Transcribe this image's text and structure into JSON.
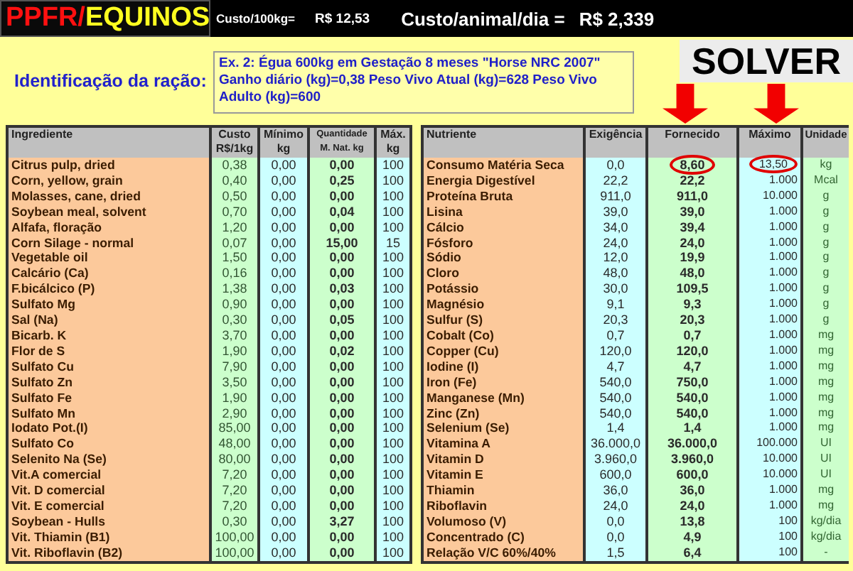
{
  "header": {
    "title_prefix": "PPFR/",
    "title_suffix": "EQUINOS",
    "cost_100kg_label": "Custo/100kg=",
    "cost_100kg_value": "R$ 12,53",
    "cost_day_label": "Custo/animal/dia =",
    "cost_day_value": "R$ 2,339"
  },
  "ration": {
    "label": "Identificação da ração:",
    "text": "Ex. 2: Égua 600kg em Gestação 8 meses  \"Horse NRC 2007\" Ganho diário (kg)=0,38  Peso Vivo Atual (kg)=628  Peso Vivo Adulto (kg)=600"
  },
  "solver_button": "SOLVER",
  "ingredients": {
    "columns": [
      "Ingrediente",
      "Custo\nR$/1kg",
      "Mínimo\nkg",
      "Quantidade\nM. Nat. kg",
      "Máx.\nkg"
    ],
    "rows": [
      {
        "name": "Citrus pulp, dried",
        "cost": "0,38",
        "min": "0,00",
        "qty": "0,00",
        "max": "100"
      },
      {
        "name": "Corn, yellow, grain",
        "cost": "0,40",
        "min": "0,00",
        "qty": "0,25",
        "max": "100"
      },
      {
        "name": "Molasses, cane, dried",
        "cost": "0,50",
        "min": "0,00",
        "qty": "0,00",
        "max": "100"
      },
      {
        "name": "Soybean meal, solvent",
        "cost": "0,70",
        "min": "0,00",
        "qty": "0,04",
        "max": "100"
      },
      {
        "name": "Alfafa, floração",
        "cost": "1,20",
        "min": "0,00",
        "qty": "0,00",
        "max": "100"
      },
      {
        "name": "Corn Silage - normal",
        "cost": "0,07",
        "min": "0,00",
        "qty": "15,00",
        "max": "15"
      },
      {
        "name": "Vegetable oil",
        "cost": "1,50",
        "min": "0,00",
        "qty": "0,00",
        "max": "100"
      },
      {
        "name": "Calcário (Ca)",
        "cost": "0,16",
        "min": "0,00",
        "qty": "0,00",
        "max": "100"
      },
      {
        "name": "F.bicálcico (P)",
        "cost": "1,38",
        "min": "0,00",
        "qty": "0,03",
        "max": "100"
      },
      {
        "name": "Sulfato Mg",
        "cost": "0,90",
        "min": "0,00",
        "qty": "0,00",
        "max": "100"
      },
      {
        "name": "Sal (Na)",
        "cost": "0,30",
        "min": "0,00",
        "qty": "0,05",
        "max": "100"
      },
      {
        "name": "Bicarb. K",
        "cost": "3,70",
        "min": "0,00",
        "qty": "0,00",
        "max": "100"
      },
      {
        "name": "Flor de S",
        "cost": "1,90",
        "min": "0,00",
        "qty": "0,02",
        "max": "100"
      },
      {
        "name": "Sulfato Cu",
        "cost": "7,90",
        "min": "0,00",
        "qty": "0,00",
        "max": "100"
      },
      {
        "name": "Sulfato Zn",
        "cost": "3,50",
        "min": "0,00",
        "qty": "0,00",
        "max": "100"
      },
      {
        "name": "Sulfato Fe",
        "cost": "1,90",
        "min": "0,00",
        "qty": "0,00",
        "max": "100"
      },
      {
        "name": "Sulfato Mn",
        "cost": "2,90",
        "min": "0,00",
        "qty": "0,00",
        "max": "100"
      },
      {
        "name": "Iodato Pot.(I)",
        "cost": "85,00",
        "min": "0,00",
        "qty": "0,00",
        "max": "100"
      },
      {
        "name": "Sulfato Co",
        "cost": "48,00",
        "min": "0,00",
        "qty": "0,00",
        "max": "100"
      },
      {
        "name": "Selenito Na (Se)",
        "cost": "80,00",
        "min": "0,00",
        "qty": "0,00",
        "max": "100"
      },
      {
        "name": "Vit.A comercial",
        "cost": "7,20",
        "min": "0,00",
        "qty": "0,00",
        "max": "100"
      },
      {
        "name": "Vit. D comercial",
        "cost": "7,20",
        "min": "0,00",
        "qty": "0,00",
        "max": "100"
      },
      {
        "name": "Vit. E comercial",
        "cost": "7,20",
        "min": "0,00",
        "qty": "0,00",
        "max": "100"
      },
      {
        "name": "Soybean - Hulls",
        "cost": "0,30",
        "min": "0,00",
        "qty": "3,27",
        "max": "100"
      },
      {
        "name": "Vit. Thiamin (B1)",
        "cost": "100,00",
        "min": "0,00",
        "qty": "0,00",
        "max": "100"
      },
      {
        "name": "Vit. Riboflavin (B2)",
        "cost": "100,00",
        "min": "0,00",
        "qty": "0,00",
        "max": "100"
      }
    ]
  },
  "nutrients": {
    "columns": [
      "Nutriente",
      "Exigência",
      "Fornecido",
      "Máximo",
      "Unidade"
    ],
    "rows": [
      {
        "name": "Consumo Matéria Seca",
        "required": "0,0",
        "supplied": "8,60",
        "maximum": "13,50",
        "unit": "kg",
        "supplied_circled": true,
        "maximum_circled": true
      },
      {
        "name": "Energia Digestível",
        "required": "22,2",
        "supplied": "22,2",
        "maximum": "1.000",
        "unit": "Mcal",
        "supplied_circled": false,
        "maximum_circled": false
      },
      {
        "name": "Proteína Bruta",
        "required": "911,0",
        "supplied": "911,0",
        "maximum": "10.000",
        "unit": "g",
        "supplied_circled": false,
        "maximum_circled": false
      },
      {
        "name": "Lisina",
        "required": "39,0",
        "supplied": "39,0",
        "maximum": "1.000",
        "unit": "g",
        "supplied_circled": false,
        "maximum_circled": false
      },
      {
        "name": "Cálcio",
        "required": "34,0",
        "supplied": "39,4",
        "maximum": "1.000",
        "unit": "g",
        "supplied_circled": false,
        "maximum_circled": false
      },
      {
        "name": "Fósforo",
        "required": "24,0",
        "supplied": "24,0",
        "maximum": "1.000",
        "unit": "g",
        "supplied_circled": false,
        "maximum_circled": false
      },
      {
        "name": "Sódio",
        "required": "12,0",
        "supplied": "19,9",
        "maximum": "1.000",
        "unit": "g",
        "supplied_circled": false,
        "maximum_circled": false
      },
      {
        "name": "Cloro",
        "required": "48,0",
        "supplied": "48,0",
        "maximum": "1.000",
        "unit": "g",
        "supplied_circled": false,
        "maximum_circled": false
      },
      {
        "name": "Potássio",
        "required": "30,0",
        "supplied": "109,5",
        "maximum": "1.000",
        "unit": "g",
        "supplied_circled": false,
        "maximum_circled": false
      },
      {
        "name": "Magnésio",
        "required": "9,1",
        "supplied": "9,3",
        "maximum": "1.000",
        "unit": "g",
        "supplied_circled": false,
        "maximum_circled": false
      },
      {
        "name": "Sulfur (S)",
        "required": "20,3",
        "supplied": "20,3",
        "maximum": "1.000",
        "unit": "g",
        "supplied_circled": false,
        "maximum_circled": false
      },
      {
        "name": "Cobalt (Co)",
        "required": "0,7",
        "supplied": "0,7",
        "maximum": "1.000",
        "unit": "mg",
        "supplied_circled": false,
        "maximum_circled": false
      },
      {
        "name": "Copper (Cu)",
        "required": "120,0",
        "supplied": "120,0",
        "maximum": "1.000",
        "unit": "mg",
        "supplied_circled": false,
        "maximum_circled": false
      },
      {
        "name": "Iodine (I)",
        "required": "4,7",
        "supplied": "4,7",
        "maximum": "1.000",
        "unit": "mg",
        "supplied_circled": false,
        "maximum_circled": false
      },
      {
        "name": "Iron (Fe)",
        "required": "540,0",
        "supplied": "750,0",
        "maximum": "1.000",
        "unit": "mg",
        "supplied_circled": false,
        "maximum_circled": false
      },
      {
        "name": "Manganese (Mn)",
        "required": "540,0",
        "supplied": "540,0",
        "maximum": "1.000",
        "unit": "mg",
        "supplied_circled": false,
        "maximum_circled": false
      },
      {
        "name": "Zinc (Zn)",
        "required": "540,0",
        "supplied": "540,0",
        "maximum": "1.000",
        "unit": "mg",
        "supplied_circled": false,
        "maximum_circled": false
      },
      {
        "name": "Selenium (Se)",
        "required": "1,4",
        "supplied": "1,4",
        "maximum": "1.000",
        "unit": "mg",
        "supplied_circled": false,
        "maximum_circled": false
      },
      {
        "name": "Vitamina A",
        "required": "36.000,0",
        "supplied": "36.000,0",
        "maximum": "100.000",
        "unit": "UI",
        "supplied_circled": false,
        "maximum_circled": false
      },
      {
        "name": "Vitamin D",
        "required": "3.960,0",
        "supplied": "3.960,0",
        "maximum": "10.000",
        "unit": "UI",
        "supplied_circled": false,
        "maximum_circled": false
      },
      {
        "name": "Vitamin E",
        "required": "600,0",
        "supplied": "600,0",
        "maximum": "10.000",
        "unit": "UI",
        "supplied_circled": false,
        "maximum_circled": false
      },
      {
        "name": "Thiamin",
        "required": "36,0",
        "supplied": "36,0",
        "maximum": "1.000",
        "unit": "mg",
        "supplied_circled": false,
        "maximum_circled": false
      },
      {
        "name": "Riboflavin",
        "required": "24,0",
        "supplied": "24,0",
        "maximum": "1.000",
        "unit": "mg",
        "supplied_circled": false,
        "maximum_circled": false
      },
      {
        "name": "Volumoso (V)",
        "required": "0,0",
        "supplied": "13,8",
        "maximum": "100",
        "unit": "kg/dia",
        "supplied_circled": false,
        "maximum_circled": false
      },
      {
        "name": "Concentrado (C)",
        "required": "0,0",
        "supplied": "4,9",
        "maximum": "100",
        "unit": "kg/dia",
        "supplied_circled": false,
        "maximum_circled": false
      },
      {
        "name": "Relação V/C 60%/40%",
        "required": "1,5",
        "supplied": "6,4",
        "maximum": "100",
        "unit": "-",
        "supplied_circled": false,
        "maximum_circled": false
      }
    ]
  }
}
